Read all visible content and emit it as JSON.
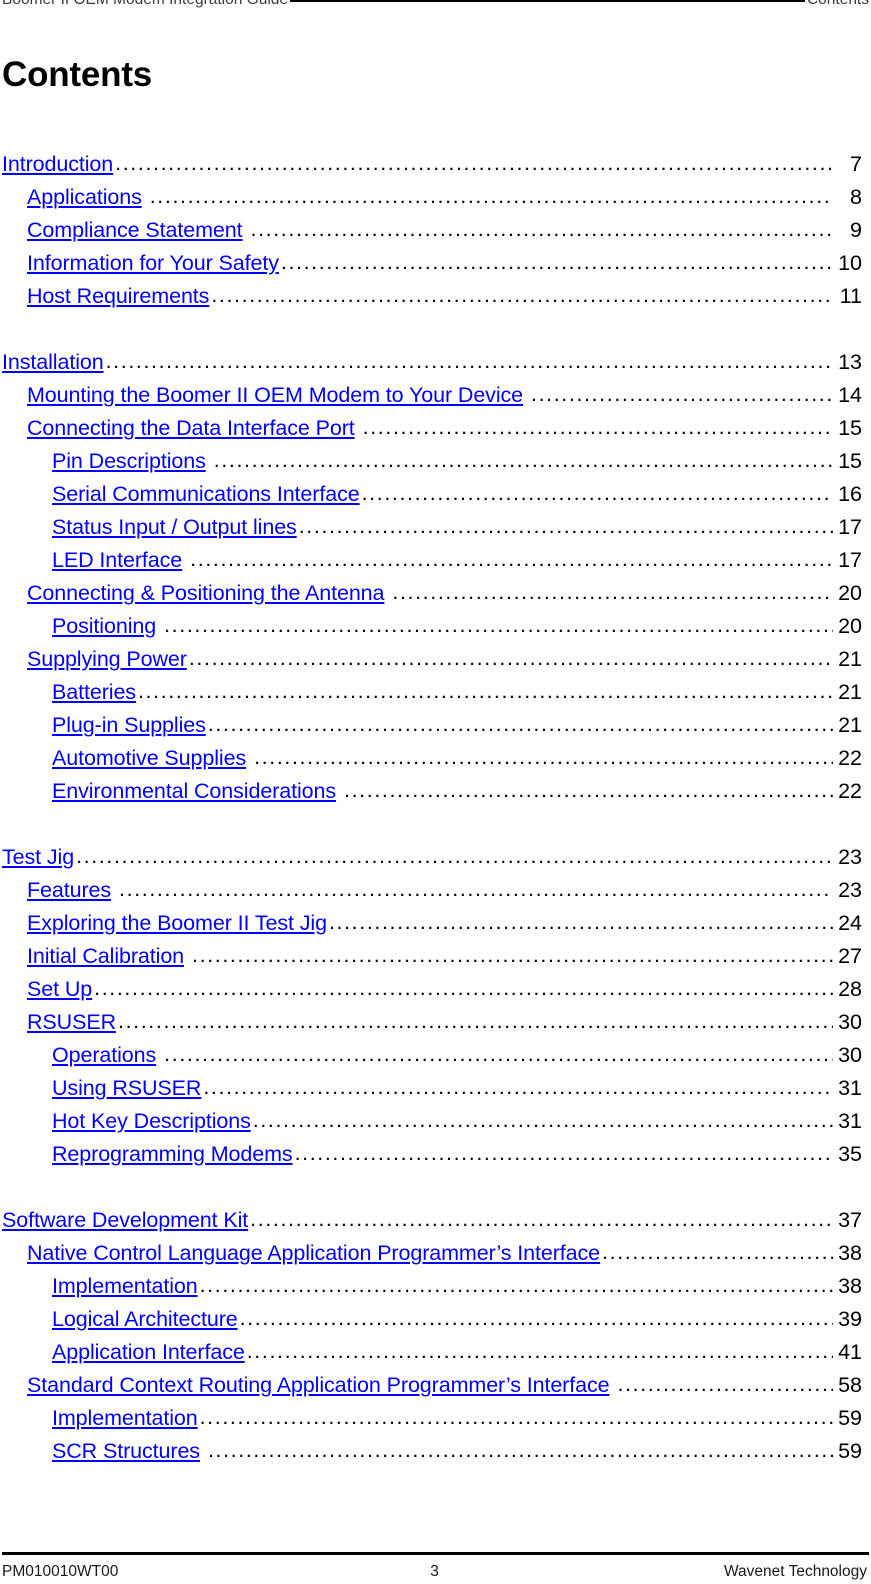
{
  "header": {
    "left": "Boomer II OEM Modem Integration Guide",
    "right": "Contents"
  },
  "title": "Contents",
  "toc": {
    "entries": [
      {
        "label": "Introduction",
        "page": "7",
        "level": 1,
        "gap": false
      },
      {
        "label": "Applications",
        "page": "8",
        "level": 2,
        "gap": true
      },
      {
        "label": "Compliance Statement",
        "page": "9",
        "level": 2,
        "gap": true
      },
      {
        "label": "Information for Your Safety",
        "page": "10",
        "level": 2,
        "gap": false
      },
      {
        "label": "Host Requirements",
        "page": "11",
        "level": 2,
        "gap": false
      },
      {
        "label": "",
        "page": "",
        "level": 0,
        "gap": false
      },
      {
        "label": "Installation",
        "page": "13",
        "level": 1,
        "gap": false
      },
      {
        "label": "Mounting the Boomer II OEM Modem to Your Device",
        "page": "14",
        "level": 2,
        "gap": true
      },
      {
        "label": "Connecting the Data Interface Port",
        "page": "15",
        "level": 2,
        "gap": true
      },
      {
        "label": "Pin Descriptions",
        "page": "15",
        "level": 3,
        "gap": true
      },
      {
        "label": "Serial Communications Interface",
        "page": "16",
        "level": 3,
        "gap": false
      },
      {
        "label": "Status Input / Output lines",
        "page": "17",
        "level": 3,
        "gap": false
      },
      {
        "label": "LED Interface",
        "page": "17",
        "level": 3,
        "gap": true
      },
      {
        "label": "Connecting & Positioning the Antenna",
        "page": "20",
        "level": 2,
        "gap": true
      },
      {
        "label": "Positioning",
        "page": "20",
        "level": 3,
        "gap": true
      },
      {
        "label": "Supplying Power",
        "page": "21",
        "level": 2,
        "gap": false
      },
      {
        "label": "Batteries",
        "page": "21",
        "level": 3,
        "gap": false
      },
      {
        "label": "Plug-in Supplies",
        "page": "21",
        "level": 3,
        "gap": false
      },
      {
        "label": "Automotive Supplies",
        "page": "22",
        "level": 3,
        "gap": true
      },
      {
        "label": "Environmental Considerations",
        "page": "22",
        "level": 3,
        "gap": true
      },
      {
        "label": "",
        "page": "",
        "level": 0,
        "gap": false
      },
      {
        "label": "Test Jig",
        "page": "23",
        "level": 1,
        "gap": false
      },
      {
        "label": "Features",
        "page": "23",
        "level": 2,
        "gap": true
      },
      {
        "label": "Exploring the Boomer II Test Jig",
        "page": "24",
        "level": 2,
        "gap": false
      },
      {
        "label": "Initial Calibration",
        "page": "27",
        "level": 2,
        "gap": true
      },
      {
        "label": "Set Up",
        "page": "28",
        "level": 2,
        "gap": false
      },
      {
        "label": "RSUSER",
        "page": "30",
        "level": 2,
        "gap": false
      },
      {
        "label": "Operations",
        "page": "30",
        "level": 3,
        "gap": true
      },
      {
        "label": "Using RSUSER",
        "page": "31",
        "level": 3,
        "gap": false
      },
      {
        "label": "Hot Key Descriptions",
        "page": "31",
        "level": 3,
        "gap": false
      },
      {
        "label": "Reprogramming Modems",
        "page": "35",
        "level": 3,
        "gap": false
      },
      {
        "label": "",
        "page": "",
        "level": 0,
        "gap": false
      },
      {
        "label": "Software Development Kit",
        "page": "37",
        "level": 1,
        "gap": false
      },
      {
        "label": "Native Control Language Application Programmer’s Interface",
        "page": "38",
        "level": 2,
        "gap": false
      },
      {
        "label": "Implementation",
        "page": "38",
        "level": 3,
        "gap": false
      },
      {
        "label": "Logical Architecture",
        "page": "39",
        "level": 3,
        "gap": false
      },
      {
        "label": "Application Interface",
        "page": "41",
        "level": 3,
        "gap": false
      },
      {
        "label": "Standard Context Routing Application Programmer’s Interface",
        "page": "58",
        "level": 2,
        "gap": true
      },
      {
        "label": "Implementation",
        "page": "59",
        "level": 3,
        "gap": false
      },
      {
        "label": "SCR Structures",
        "page": "59",
        "level": 3,
        "gap": true
      }
    ]
  },
  "footer": {
    "left": "PM010010WT00",
    "center": "3",
    "right": "Wavenet Technology"
  },
  "colors": {
    "link": "#0000ff",
    "text": "#000000",
    "background": "#ffffff"
  }
}
